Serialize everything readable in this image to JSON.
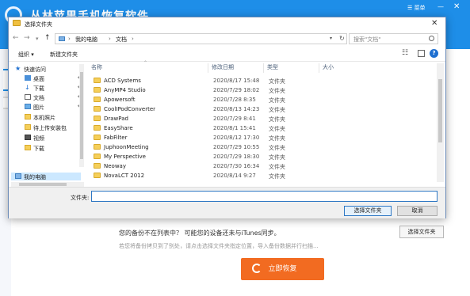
{
  "app": {
    "title": "丛林苹果手机恢复软件",
    "menu_label": "菜单",
    "minimize_icon": "minimize-icon",
    "close_icon": "close-icon",
    "notice_text": "您的备份不在列表中？ 可能您的设备还未与iTunes同步。",
    "hint_text": "若您将备份拷贝到了别处，请点击选择文件夹指定位置，导入备份数据并行扫描...",
    "select_folder_label": "选择文件夹",
    "restore_label": "立即恢复",
    "accent_color": "#1e8ee8",
    "restore_color": "#f26b21"
  },
  "dialog": {
    "title": "选择文件夹",
    "breadcrumb": [
      "我的电脑",
      "文档"
    ],
    "search_placeholder": "搜索\"文档\"",
    "toolbar": {
      "organize_label": "组织 ▾",
      "new_folder_label": "新建文件夹"
    },
    "nav_pane": [
      {
        "label": "快速访问",
        "icon": "star-icon",
        "pinned": false
      },
      {
        "label": "桌面",
        "icon": "desktop-icon",
        "pinned": true
      },
      {
        "label": "下载",
        "icon": "download-icon",
        "pinned": true
      },
      {
        "label": "文档",
        "icon": "document-icon",
        "pinned": true
      },
      {
        "label": "图片",
        "icon": "picture-icon",
        "pinned": true
      },
      {
        "label": "本机照片",
        "icon": "folder-icon",
        "pinned": false
      },
      {
        "label": "待上传安装包",
        "icon": "folder-icon",
        "pinned": false
      },
      {
        "label": "视频",
        "icon": "video-icon",
        "pinned": false
      },
      {
        "label": "下载",
        "icon": "folder-icon",
        "pinned": false
      },
      {
        "label": "我的电脑",
        "icon": "computer-icon",
        "pinned": false
      }
    ],
    "columns": [
      "名称",
      "修改日期",
      "类型",
      "大小"
    ],
    "files": [
      {
        "name": "ACD Systems",
        "date": "2020/8/17 15:48",
        "type": "文件夹"
      },
      {
        "name": "AnyMP4 Studio",
        "date": "2020/7/29 18:02",
        "type": "文件夹"
      },
      {
        "name": "Apowersoft",
        "date": "2020/7/28 8:35",
        "type": "文件夹"
      },
      {
        "name": "CoolIPodConverter",
        "date": "2020/8/13 14:23",
        "type": "文件夹"
      },
      {
        "name": "DrawPad",
        "date": "2020/7/29 8:41",
        "type": "文件夹"
      },
      {
        "name": "EasyShare",
        "date": "2020/8/1 15:41",
        "type": "文件夹"
      },
      {
        "name": "FabFilter",
        "date": "2020/8/12 17:30",
        "type": "文件夹"
      },
      {
        "name": "JuphoonMeeting",
        "date": "2020/7/29 10:55",
        "type": "文件夹"
      },
      {
        "name": "My Perspective",
        "date": "2020/7/29 18:30",
        "type": "文件夹"
      },
      {
        "name": "Neoway",
        "date": "2020/7/30 16:34",
        "type": "文件夹"
      },
      {
        "name": "NovaLCT 2012",
        "date": "2020/8/14 9:27",
        "type": "文件夹"
      }
    ],
    "folder_label": "文件夹:",
    "folder_value": "",
    "select_button": "选择文件夹",
    "cancel_button": "取消"
  }
}
